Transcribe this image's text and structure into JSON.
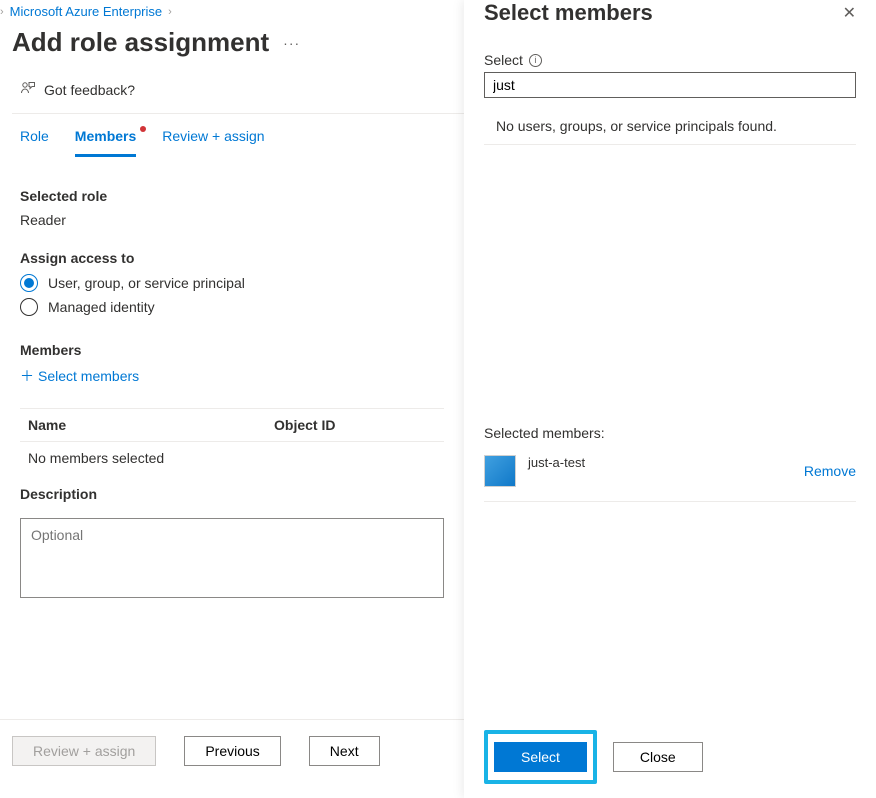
{
  "breadcrumb": {
    "item": "Microsoft Azure Enterprise"
  },
  "page": {
    "title": "Add role assignment",
    "feedback": "Got feedback?"
  },
  "tabs": {
    "role": "Role",
    "members": "Members",
    "review": "Review + assign"
  },
  "selected_role": {
    "label": "Selected role",
    "value": "Reader"
  },
  "assign_access": {
    "label": "Assign access to",
    "opt1": "User, group, or service principal",
    "opt2": "Managed identity"
  },
  "members_section": {
    "label": "Members",
    "select_link": "Select members",
    "col_name": "Name",
    "col_object": "Object ID",
    "empty": "No members selected"
  },
  "description": {
    "label": "Description",
    "placeholder": "Optional"
  },
  "footer": {
    "review": "Review + assign",
    "previous": "Previous",
    "next": "Next"
  },
  "panel": {
    "title": "Select members",
    "search_label": "Select",
    "search_value": "just",
    "no_results": "No users, groups, or service principals found.",
    "selected_label": "Selected members:",
    "member_name": "just-a-test",
    "remove": "Remove",
    "select_btn": "Select",
    "close_btn": "Close"
  }
}
